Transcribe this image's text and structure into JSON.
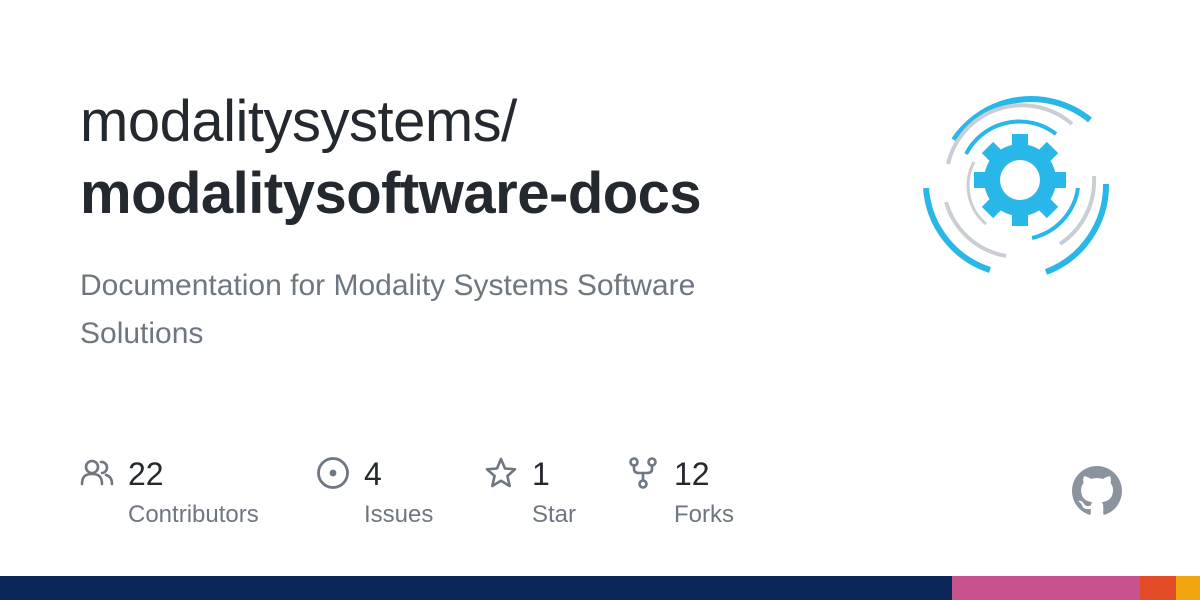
{
  "repo": {
    "owner": "modalitysystems/",
    "name": "modalitysoftware-docs",
    "description": "Documentation for Modality Systems Software Solutions"
  },
  "stats": {
    "contributors": {
      "count": "22",
      "label": "Contributors",
      "icon": "people-icon"
    },
    "issues": {
      "count": "4",
      "label": "Issues",
      "icon": "issue-opened-icon"
    },
    "stars": {
      "count": "1",
      "label": "Star",
      "icon": "star-icon"
    },
    "forks": {
      "count": "12",
      "label": "Forks",
      "icon": "repo-forked-icon"
    }
  },
  "logo": {
    "icon": "gear-logo-icon",
    "accent_color": "#29b6e8",
    "ring_color": "#c8ced4"
  },
  "github_icon": "github-mark-icon",
  "language_bar": {
    "colors": [
      "#0b2758",
      "#c6538c",
      "#e34c26",
      "#f1a50f"
    ],
    "fractions": [
      0.793,
      0.157,
      0.03,
      0.02
    ]
  }
}
